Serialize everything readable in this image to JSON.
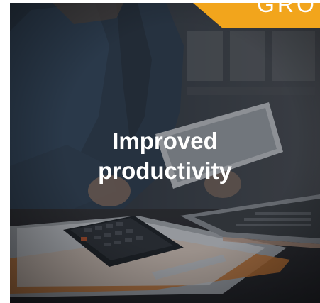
{
  "card": {
    "ribbon_text": "GRO",
    "caption_line_1": "Improved",
    "caption_line_2": "productivity"
  },
  "colors": {
    "ribbon": "#f2a51c",
    "overlay": "#1c2129",
    "text": "#ffffff"
  },
  "icons": [
    "tablet",
    "calculator",
    "laptop-keyboard",
    "documents"
  ]
}
